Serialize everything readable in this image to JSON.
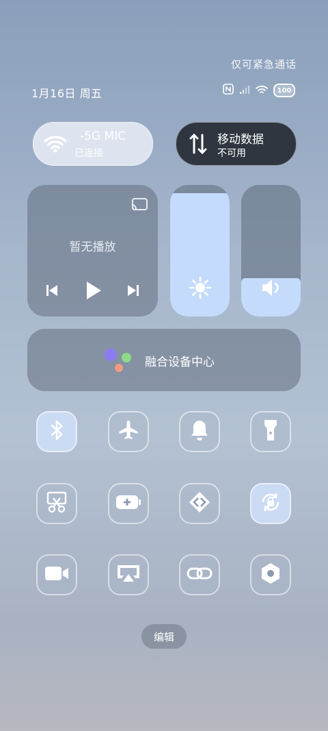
{
  "status_bar": {
    "emergency_text": "仅可紧急通话",
    "date": "1月16日 周五",
    "battery": "100"
  },
  "wifi_tile": {
    "title": "-5G   MIC",
    "subtitle": "已连接"
  },
  "mobile_data_tile": {
    "title": "移动数据",
    "subtitle": "不可用"
  },
  "media": {
    "empty_text": "暂无播放"
  },
  "brightness": {
    "level": 0.94
  },
  "volume": {
    "level": 0.29
  },
  "fusion_center": {
    "label": "融合设备中心"
  },
  "toggles": [
    {
      "name": "bluetooth",
      "active": true
    },
    {
      "name": "airplane-mode",
      "active": false
    },
    {
      "name": "ring-mode",
      "active": false
    },
    {
      "name": "flashlight",
      "active": false
    },
    {
      "name": "screenshot",
      "active": false
    },
    {
      "name": "battery-saver",
      "active": false
    },
    {
      "name": "cast",
      "active": false
    },
    {
      "name": "rotation-lock",
      "active": true
    },
    {
      "name": "screen-recorder",
      "active": false
    },
    {
      "name": "screen-mirroring",
      "active": false
    },
    {
      "name": "link-sharing",
      "active": false
    },
    {
      "name": "settings",
      "active": false
    }
  ],
  "edit_button": {
    "label": "编辑"
  },
  "colors": {
    "active_tile": "#c5dbfb",
    "card": "#64708c"
  }
}
